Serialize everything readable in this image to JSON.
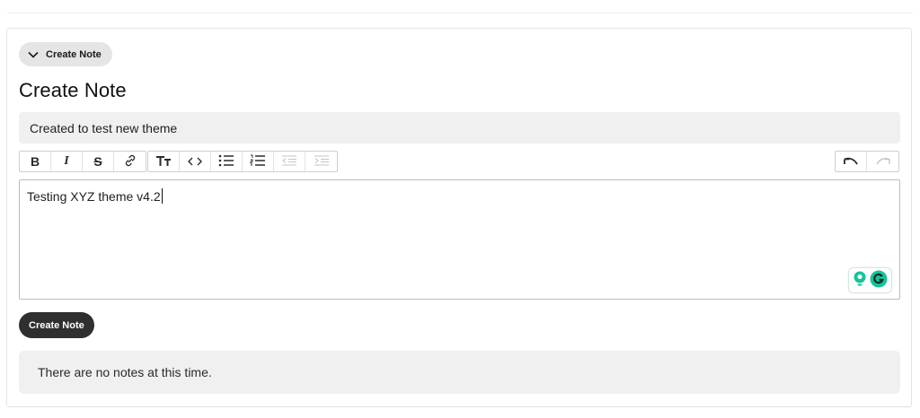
{
  "header": {
    "toggle_label": "Create Note",
    "page_title": "Create Note"
  },
  "form": {
    "title_value": "Created to test new theme",
    "editor_text": "Testing XYZ theme v4.2",
    "submit_label": "Create Note"
  },
  "toolbar": {
    "buttons": [
      {
        "name": "bold-button",
        "icon": "bold-icon",
        "glyph": "B"
      },
      {
        "name": "italic-button",
        "icon": "italic-icon",
        "glyph": "I"
      },
      {
        "name": "strikethrough-button",
        "icon": "strikethrough-icon",
        "glyph": "S"
      },
      {
        "name": "link-button",
        "icon": "link-icon"
      },
      {
        "name": "heading-button",
        "icon": "text-size-icon"
      },
      {
        "name": "code-button",
        "icon": "code-icon",
        "glyph": "‹›"
      },
      {
        "name": "bullet-list-button",
        "icon": "bullet-list-icon"
      },
      {
        "name": "numbered-list-button",
        "icon": "numbered-list-icon"
      },
      {
        "name": "outdent-button",
        "icon": "outdent-icon",
        "disabled": true
      },
      {
        "name": "indent-button",
        "icon": "indent-icon",
        "disabled": true
      }
    ],
    "history": [
      {
        "name": "undo-button",
        "icon": "undo-icon"
      },
      {
        "name": "redo-button",
        "icon": "redo-icon",
        "disabled": true
      }
    ]
  },
  "notes": {
    "empty_message": "There are no notes at this time."
  },
  "colors": {
    "accent_dark": "#2f2f2f",
    "field_bg": "#f0f0f0",
    "grammarly_green": "#15c39a"
  }
}
